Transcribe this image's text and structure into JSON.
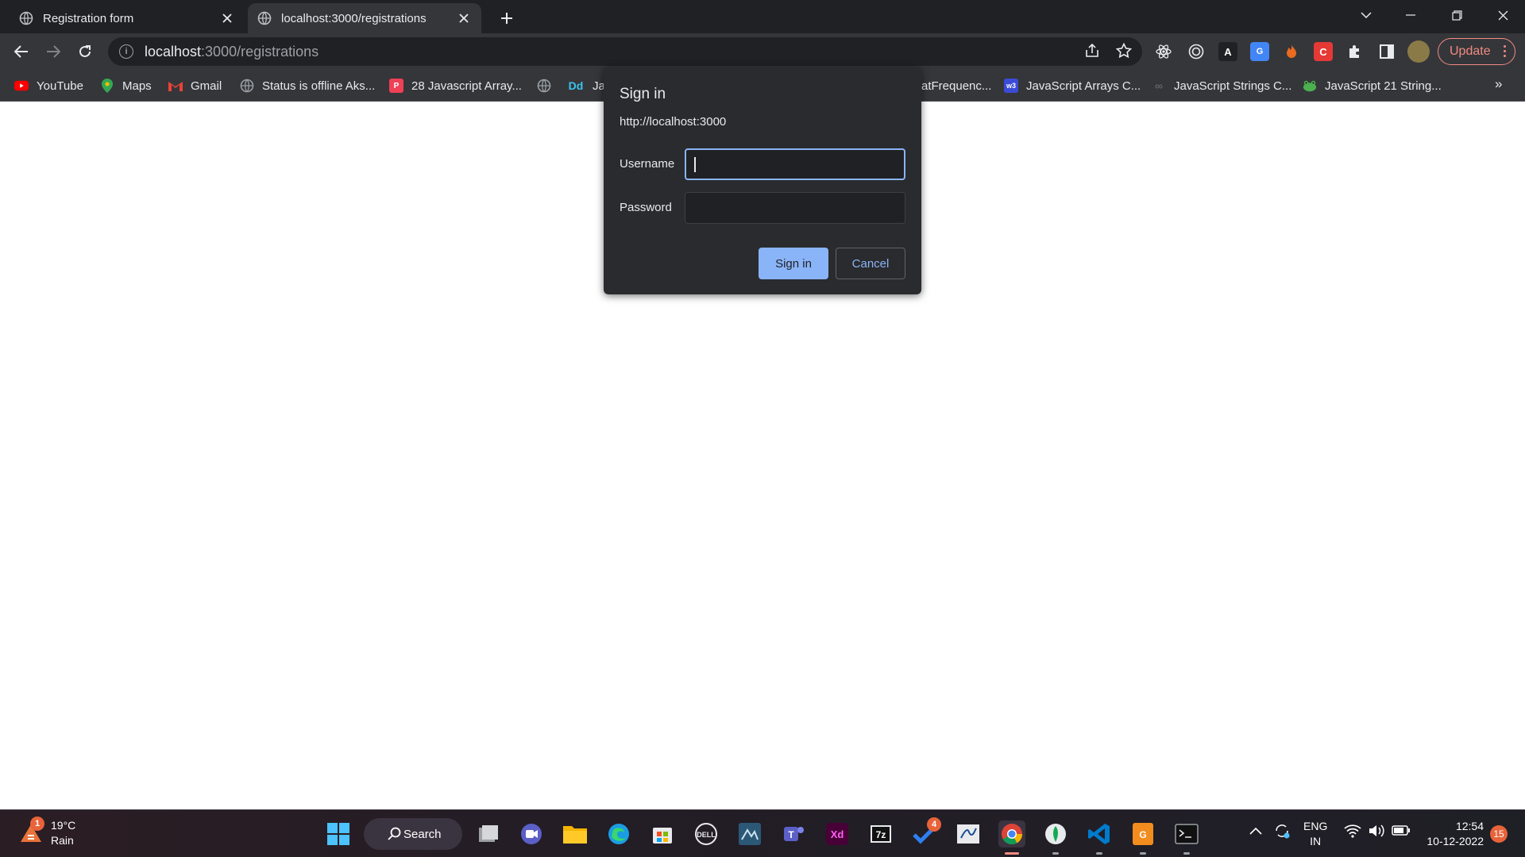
{
  "browser": {
    "tabs": [
      {
        "title": "Registration form",
        "active": false
      },
      {
        "title": "localhost:3000/registrations",
        "active": true
      }
    ],
    "address": {
      "host": "localhost",
      "path": ":3000/registrations"
    },
    "update_label": "Update"
  },
  "bookmarks": [
    {
      "label": "YouTube",
      "icon": "youtube-icon",
      "color": "#ff0000"
    },
    {
      "label": "Maps",
      "icon": "maps-icon",
      "color": "#34a853"
    },
    {
      "label": "Gmail",
      "icon": "gmail-icon",
      "color": "#ea4335"
    },
    {
      "label": "Status is offline Aks...",
      "icon": "globe-icon",
      "color": "#9aa0a6"
    },
    {
      "label": "28 Javascript Array...",
      "icon": "pocket-icon",
      "color": "#ef4056"
    },
    {
      "label": "",
      "icon": "globe-icon",
      "color": "#9aa0a6"
    },
    {
      "label": "Ja",
      "icon": "dd-icon",
      "color": "#1da1f2",
      "glyph": "Dd"
    },
    {
      "label": "atFrequenc...",
      "icon": "none",
      "color": ""
    },
    {
      "label": "JavaScript Arrays C...",
      "icon": "w3-icon",
      "color": "#3b4bd8"
    },
    {
      "label": "JavaScript Strings C...",
      "icon": "infinity-icon",
      "color": "#5f6368"
    },
    {
      "label": "JavaScript 21 String...",
      "icon": "frog-icon",
      "color": "#4caf50"
    }
  ],
  "dialog": {
    "title": "Sign in",
    "origin": "http://localhost:3000",
    "username_label": "Username",
    "username_value": "",
    "password_label": "Password",
    "password_value": "",
    "signin_label": "Sign in",
    "cancel_label": "Cancel"
  },
  "taskbar": {
    "weather": {
      "temp": "19°C",
      "condition": "Rain",
      "badge": "1"
    },
    "search_label": "Search",
    "todo_badge": "4",
    "lang": {
      "line1": "ENG",
      "line2": "IN"
    },
    "clock": {
      "time": "12:54",
      "date": "10-12-2022"
    },
    "notifications": "15"
  },
  "colors": {
    "accent": "#8ab4f8",
    "frame": "#202124",
    "toolbar": "#35363a",
    "update": "#f28b82"
  }
}
